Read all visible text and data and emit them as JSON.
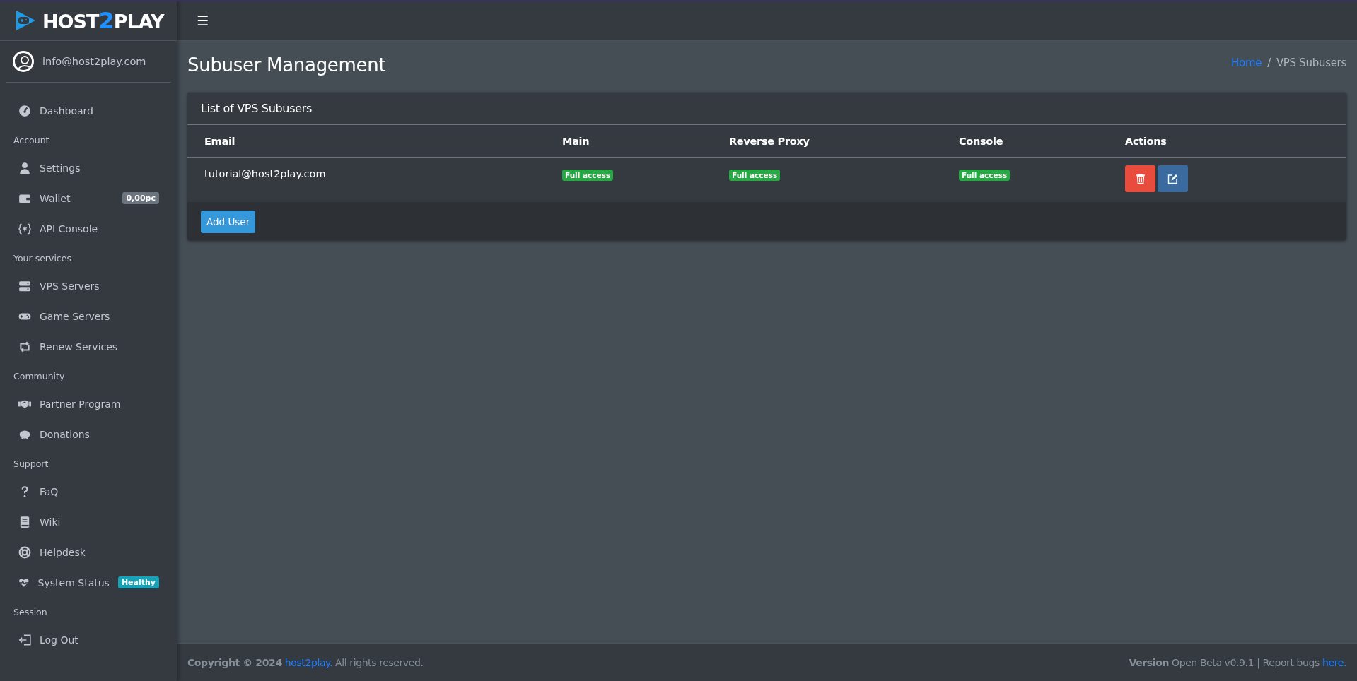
{
  "logo": {
    "parts": [
      "HOST",
      "2",
      "PLAY"
    ]
  },
  "user": {
    "email": "info@host2play.com"
  },
  "sidebar": {
    "sections": [
      {
        "items": [
          {
            "label": "Dashboard"
          }
        ]
      },
      {
        "header": "Account",
        "items": [
          {
            "label": "Settings"
          },
          {
            "label": "Wallet",
            "badge": "0,00pc",
            "color": "#6c757d"
          },
          {
            "label": "API Console"
          }
        ]
      },
      {
        "header": "Your services",
        "items": [
          {
            "label": "VPS Servers"
          },
          {
            "label": "Game Servers"
          },
          {
            "label": "Renew Services"
          }
        ]
      },
      {
        "header": "Community",
        "items": [
          {
            "label": "Partner Program"
          },
          {
            "label": "Donations"
          }
        ]
      },
      {
        "header": "Support",
        "items": [
          {
            "label": "FaQ"
          },
          {
            "label": "Wiki"
          },
          {
            "label": "Helpdesk"
          },
          {
            "label": "System Status",
            "badge": "Healthy",
            "color": "#17a2b8"
          }
        ]
      },
      {
        "header": "Session",
        "items": [
          {
            "label": "Log Out"
          }
        ]
      }
    ]
  },
  "topbar": {
    "menu_icon": "☰"
  },
  "page": {
    "title": "Subuser Management",
    "breadcrumb": [
      {
        "label": "Home",
        "link": true
      },
      {
        "label": "VPS Subusers",
        "link": false
      }
    ],
    "breadcrumb_separator": "/"
  },
  "card": {
    "title": "List of VPS Subusers",
    "table": {
      "columns": [
        "Email",
        "Main",
        "Reverse Proxy",
        "Console",
        "Actions"
      ],
      "rows": [
        {
          "email": "tutorial@host2play.com",
          "main": "Full access",
          "reverse_proxy": "Full access",
          "console": "Full access",
          "actions": [
            {
              "kind": "delete"
            },
            {
              "kind": "edit"
            }
          ]
        }
      ]
    },
    "add_button": "Add User"
  },
  "footer": {
    "left": {
      "prefix": "**Copyright © 2024**",
      "link": "host2play.",
      "suffix": " All rights reserved."
    },
    "right": {
      "prefix": "**Version** Open Beta v0.9.1 | Report bugs",
      "link": "here."
    }
  }
}
